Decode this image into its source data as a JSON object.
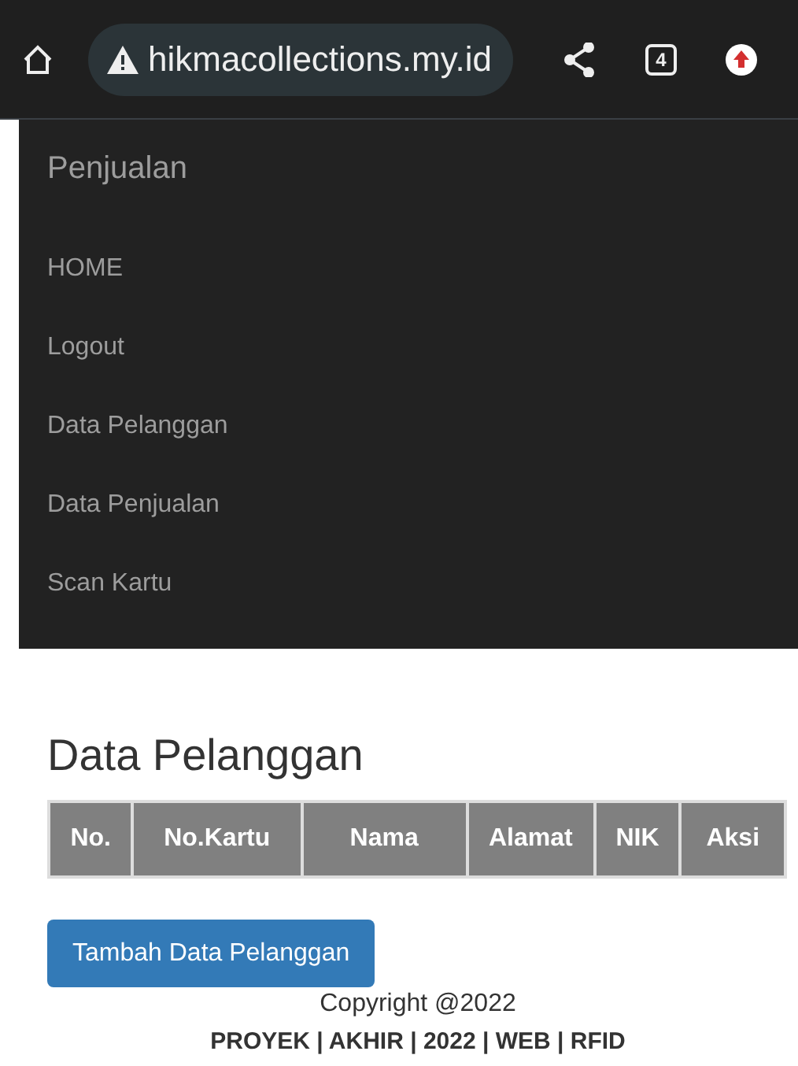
{
  "browser": {
    "url": "hikmacollections.my.id",
    "tab_count": "4"
  },
  "navbar": {
    "brand": "Penjualan",
    "items": [
      {
        "label": "HOME"
      },
      {
        "label": "Logout"
      },
      {
        "label": "Data Pelanggan"
      },
      {
        "label": "Data Penjualan"
      },
      {
        "label": "Scan Kartu"
      }
    ]
  },
  "page": {
    "title": "Data Pelanggan",
    "table": {
      "columns": [
        "No.",
        "No.Kartu",
        "Nama",
        "Alamat",
        "NIK",
        "Aksi"
      ]
    },
    "add_button": "Tambah Data Pelanggan"
  },
  "footer": {
    "copyright": "Copyright @2022",
    "credits": "PROYEK | AKHIR | 2022 | WEB | RFID"
  }
}
